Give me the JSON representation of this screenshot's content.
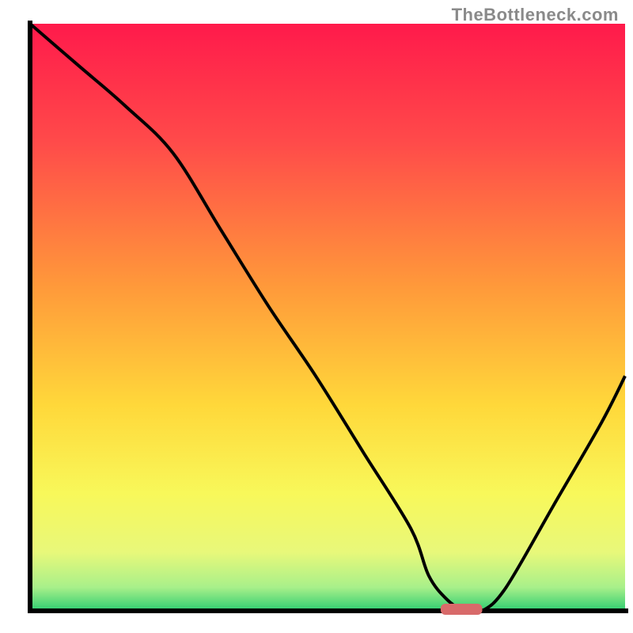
{
  "watermark": "TheBottleneck.com",
  "chart_data": {
    "type": "line",
    "title": "",
    "xlabel": "",
    "ylabel": "",
    "xlim": [
      0,
      100
    ],
    "ylim": [
      0,
      100
    ],
    "x": [
      0,
      8,
      16,
      24,
      32,
      40,
      48,
      56,
      64,
      67,
      70,
      73,
      76,
      80,
      88,
      96,
      100
    ],
    "values": [
      100,
      93,
      86,
      78,
      65,
      52,
      40,
      27,
      14,
      6,
      2,
      0,
      0,
      4,
      18,
      32,
      40
    ],
    "marker": {
      "x_start": 69,
      "x_end": 76,
      "y": 0
    },
    "background": {
      "type": "vertical-gradient",
      "stops": [
        {
          "pos": 0.0,
          "color": "#ff1a4b"
        },
        {
          "pos": 0.2,
          "color": "#ff4a4a"
        },
        {
          "pos": 0.45,
          "color": "#ff9a3a"
        },
        {
          "pos": 0.65,
          "color": "#ffd83a"
        },
        {
          "pos": 0.8,
          "color": "#f8f85a"
        },
        {
          "pos": 0.9,
          "color": "#e8f87a"
        },
        {
          "pos": 0.96,
          "color": "#a8f08a"
        },
        {
          "pos": 1.0,
          "color": "#2ecc71"
        }
      ]
    },
    "axis_color": "#000000",
    "line_color": "#000000",
    "marker_color": "#d86a6a"
  }
}
